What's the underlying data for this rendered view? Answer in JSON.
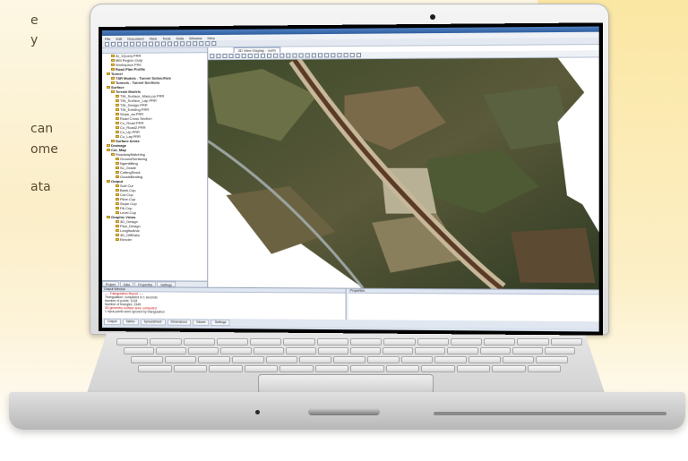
{
  "marketing": {
    "lines": [
      "e",
      "y",
      "",
      "",
      "can",
      "ome",
      "ata"
    ]
  },
  "app": {
    "window_title": "",
    "menu": [
      "File",
      "Edit",
      "Document",
      "View",
      "Tools",
      "Data",
      "Window",
      "Help"
    ],
    "tree_header": "",
    "tree_items": [
      {
        "label": "At_1Query.PRR",
        "level": 2,
        "bold": false
      },
      {
        "label": "MM Region.Outp",
        "level": 2,
        "bold": false
      },
      {
        "label": "Workspace.PKK",
        "level": 2,
        "bold": false
      },
      {
        "label": "Road Plan Profile",
        "level": 2,
        "bold": true
      },
      {
        "label": "Tunnel",
        "level": 1,
        "bold": true
      },
      {
        "label": "TSR Models - Tunnel Subsurface",
        "level": 2,
        "bold": true
      },
      {
        "label": "Tunnels - Tunnel Sections",
        "level": 2,
        "bold": true
      },
      {
        "label": "Surface",
        "level": 1,
        "bold": true
      },
      {
        "label": "Terrain Models",
        "level": 2,
        "bold": true
      },
      {
        "label": "TIN_Surface_Mass.pp.PRR",
        "level": 3,
        "bold": false
      },
      {
        "label": "TIN_Surface_Lap.PRR",
        "level": 3,
        "bold": false
      },
      {
        "label": "TIN_Design.PRR",
        "level": 3,
        "bold": false
      },
      {
        "label": "TIN_Existing.PRR",
        "level": 3,
        "bold": false
      },
      {
        "label": "Slope_sa.PRR",
        "level": 3,
        "bold": false
      },
      {
        "label": "Road Cross Section",
        "level": 3,
        "bold": false
      },
      {
        "label": "Co_Road.PRR",
        "level": 3,
        "bold": false
      },
      {
        "label": "Co_Road2.PRR",
        "level": 3,
        "bold": false
      },
      {
        "label": "Co_Up.PRR",
        "level": 3,
        "bold": false
      },
      {
        "label": "Co_Lay.PRR",
        "level": 3,
        "bold": false
      },
      {
        "label": "Surface Areas",
        "level": 2,
        "bold": true
      },
      {
        "label": "Drainage",
        "level": 1,
        "bold": true
      },
      {
        "label": "Cut_Map",
        "level": 1,
        "bold": true
      },
      {
        "label": "RoadwayMatching",
        "level": 2,
        "bold": false
      },
      {
        "label": "GroundSurfacing",
        "level": 3,
        "bold": false
      },
      {
        "label": "Ngentiliting",
        "level": 3,
        "bold": false
      },
      {
        "label": "Sc_Grade",
        "level": 3,
        "bold": false
      },
      {
        "label": "CuttingStock",
        "level": 3,
        "bold": false
      },
      {
        "label": "GoodsBinding",
        "level": 3,
        "bold": false
      },
      {
        "label": "Output",
        "level": 1,
        "bold": true
      },
      {
        "label": "Surf.Cut",
        "level": 3,
        "bold": false
      },
      {
        "label": "Bank.Cup",
        "level": 3,
        "bold": false
      },
      {
        "label": "Cut.Cup",
        "level": 3,
        "bold": false
      },
      {
        "label": "Pline.Cup",
        "level": 3,
        "bold": false
      },
      {
        "label": "Slope.Cup",
        "level": 3,
        "bold": false
      },
      {
        "label": "Fill.Cup",
        "level": 3,
        "bold": false
      },
      {
        "label": "Level.Cup",
        "level": 3,
        "bold": false
      },
      {
        "label": "Graphic Views",
        "level": 1,
        "bold": true
      },
      {
        "label": "3D_Design",
        "level": 3,
        "bold": false
      },
      {
        "label": "Plan_Design",
        "level": 3,
        "bold": false
      },
      {
        "label": "Longitudinal",
        "level": 3,
        "bold": false
      },
      {
        "label": "3D_DiffData",
        "level": 3,
        "bold": false
      },
      {
        "label": "Render",
        "level": 3,
        "bold": false
      }
    ],
    "tree_tabs": [
      "Project",
      "Data",
      "Properties",
      "Settings"
    ],
    "map_tab": "3D View Display - north",
    "output_header": "Output Window",
    "output_lines": [
      {
        "text": "---- Triangulation Report ----",
        "red": true
      },
      {
        "text": "Triangulation: completed in 1 seconds",
        "red": false
      },
      {
        "text": "Number of points: 1234",
        "red": false
      },
      {
        "text": "Number of triangles: 2345",
        "red": false
      },
      {
        "text": "3D geometry surface area: computed",
        "red": true
      },
      {
        "text": "1 input points were ignored by triangulation",
        "red": false
      }
    ],
    "props_header": "Properties",
    "bottom_tabs": [
      "Output",
      "Tables",
      "Spreadsheet",
      "Dimensions",
      "Viewer",
      "Settings"
    ]
  }
}
